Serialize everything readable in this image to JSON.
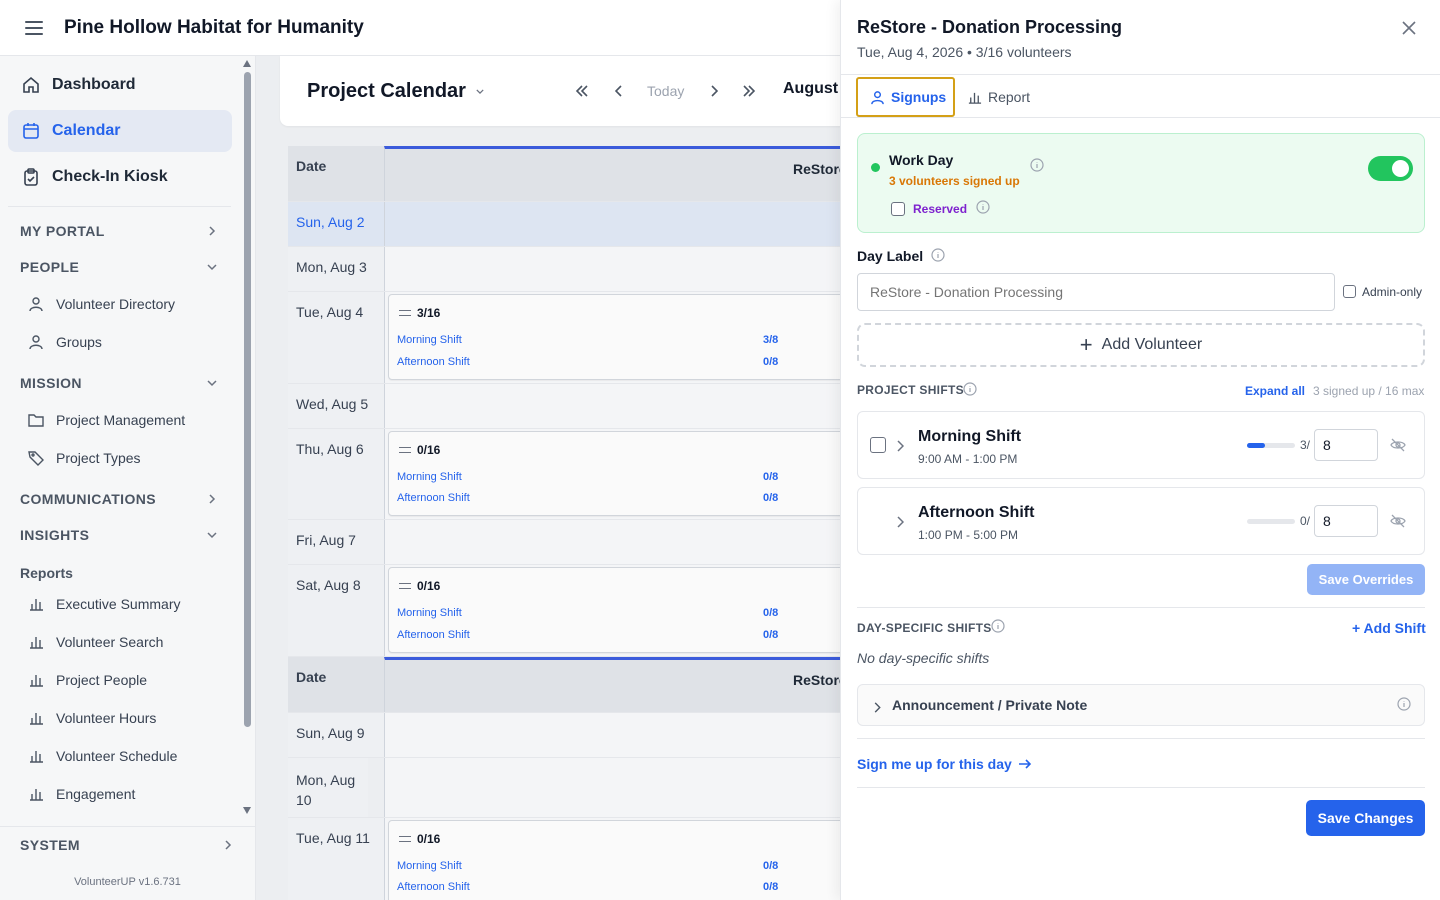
{
  "app": {
    "org_name": "Pine Hollow Habitat for Humanity",
    "version": "VolunteerUP v1.6.731"
  },
  "sidebar": {
    "main_items": [
      {
        "label": "Dashboard",
        "icon": "home-icon"
      },
      {
        "label": "Calendar",
        "icon": "calendar-icon",
        "active": true
      },
      {
        "label": "Check-In Kiosk",
        "icon": "clipboard-check-icon"
      }
    ],
    "sections": {
      "my_portal": "MY PORTAL",
      "people": "PEOPLE",
      "mission": "MISSION",
      "communications": "COMMUNICATIONS",
      "insights": "INSIGHTS",
      "system": "SYSTEM"
    },
    "people_items": [
      "Volunteer Directory",
      "Groups"
    ],
    "mission_items": [
      "Project Management",
      "Project Types"
    ],
    "reports_label": "Reports",
    "report_items": [
      "Executive Summary",
      "Volunteer Search",
      "Project People",
      "Volunteer Hours",
      "Volunteer Schedule",
      "Engagement"
    ]
  },
  "calendar": {
    "title": "Project Calendar",
    "today_label": "Today",
    "month_label": "August ",
    "date_header": "Date",
    "project_header": "ReStore",
    "rows": [
      {
        "date": "Sun, Aug 2"
      },
      {
        "date": "Mon, Aug 3"
      },
      {
        "date": "Tue, Aug 4",
        "count": "3/16",
        "morning_label": "Morning Shift",
        "morning": "3/8",
        "afternoon_label": "Afternoon Shift",
        "afternoon": "0/8"
      },
      {
        "date": "Wed, Aug 5"
      },
      {
        "date": "Thu, Aug 6",
        "count": "0/16",
        "morning_label": "Morning Shift",
        "morning": "0/8",
        "afternoon_label": "Afternoon Shift",
        "afternoon": "0/8"
      },
      {
        "date": "Fri, Aug 7"
      },
      {
        "date": "Sat, Aug 8",
        "count": "0/16",
        "morning_label": "Morning Shift",
        "morning": "0/8",
        "afternoon_label": "Afternoon Shift",
        "afternoon": "0/8"
      },
      {
        "date": "Sun, Aug 9"
      },
      {
        "date": "Mon, Aug 10"
      },
      {
        "date": "Tue, Aug 11",
        "count": "0/16",
        "morning_label": "Morning Shift",
        "morning": "0/8",
        "afternoon_label": "Afternoon Shift",
        "afternoon": "0/8"
      }
    ]
  },
  "panel": {
    "title": "ReStore - Donation Processing",
    "subtitle": "Tue, Aug 4, 2026 • 3/16 volunteers",
    "tabs": {
      "signups": "Signups",
      "report": "Report"
    },
    "workday": {
      "label": "Work Day",
      "count": "3 volunteers signed up",
      "reserved": "Reserved",
      "enabled": true
    },
    "day_label": {
      "title": "Day Label",
      "placeholder": "ReStore - Donation Processing",
      "admin_only": "Admin-only"
    },
    "add_volunteer": "Add Volunteer",
    "project_shifts": {
      "heading": "PROJECT SHIFTS",
      "expand_all": "Expand all",
      "total": "3 signed up / 16 max",
      "shifts": [
        {
          "name": "Morning Shift",
          "time": "9:00 AM - 1:00 PM",
          "filled": "3/",
          "capacity": "8",
          "fill_fraction": 0.375
        },
        {
          "name": "Afternoon Shift",
          "time": "1:00 PM - 5:00 PM",
          "filled": "0/",
          "capacity": "8",
          "fill_fraction": 0
        }
      ],
      "save_overrides": "Save Overrides"
    },
    "day_specific": {
      "heading": "DAY-SPECIFIC SHIFTS",
      "add_shift": "+ Add Shift",
      "empty": "No day-specific shifts"
    },
    "announcement": "Announcement / Private Note",
    "sign_me_up": "Sign me up for this day",
    "save_changes": "Save Changes"
  },
  "colors": {
    "accent": "#2563eb",
    "success": "#22c55e",
    "warning": "#d97706",
    "reserved": "#7e22ce",
    "tab_focus": "#d4a017"
  }
}
